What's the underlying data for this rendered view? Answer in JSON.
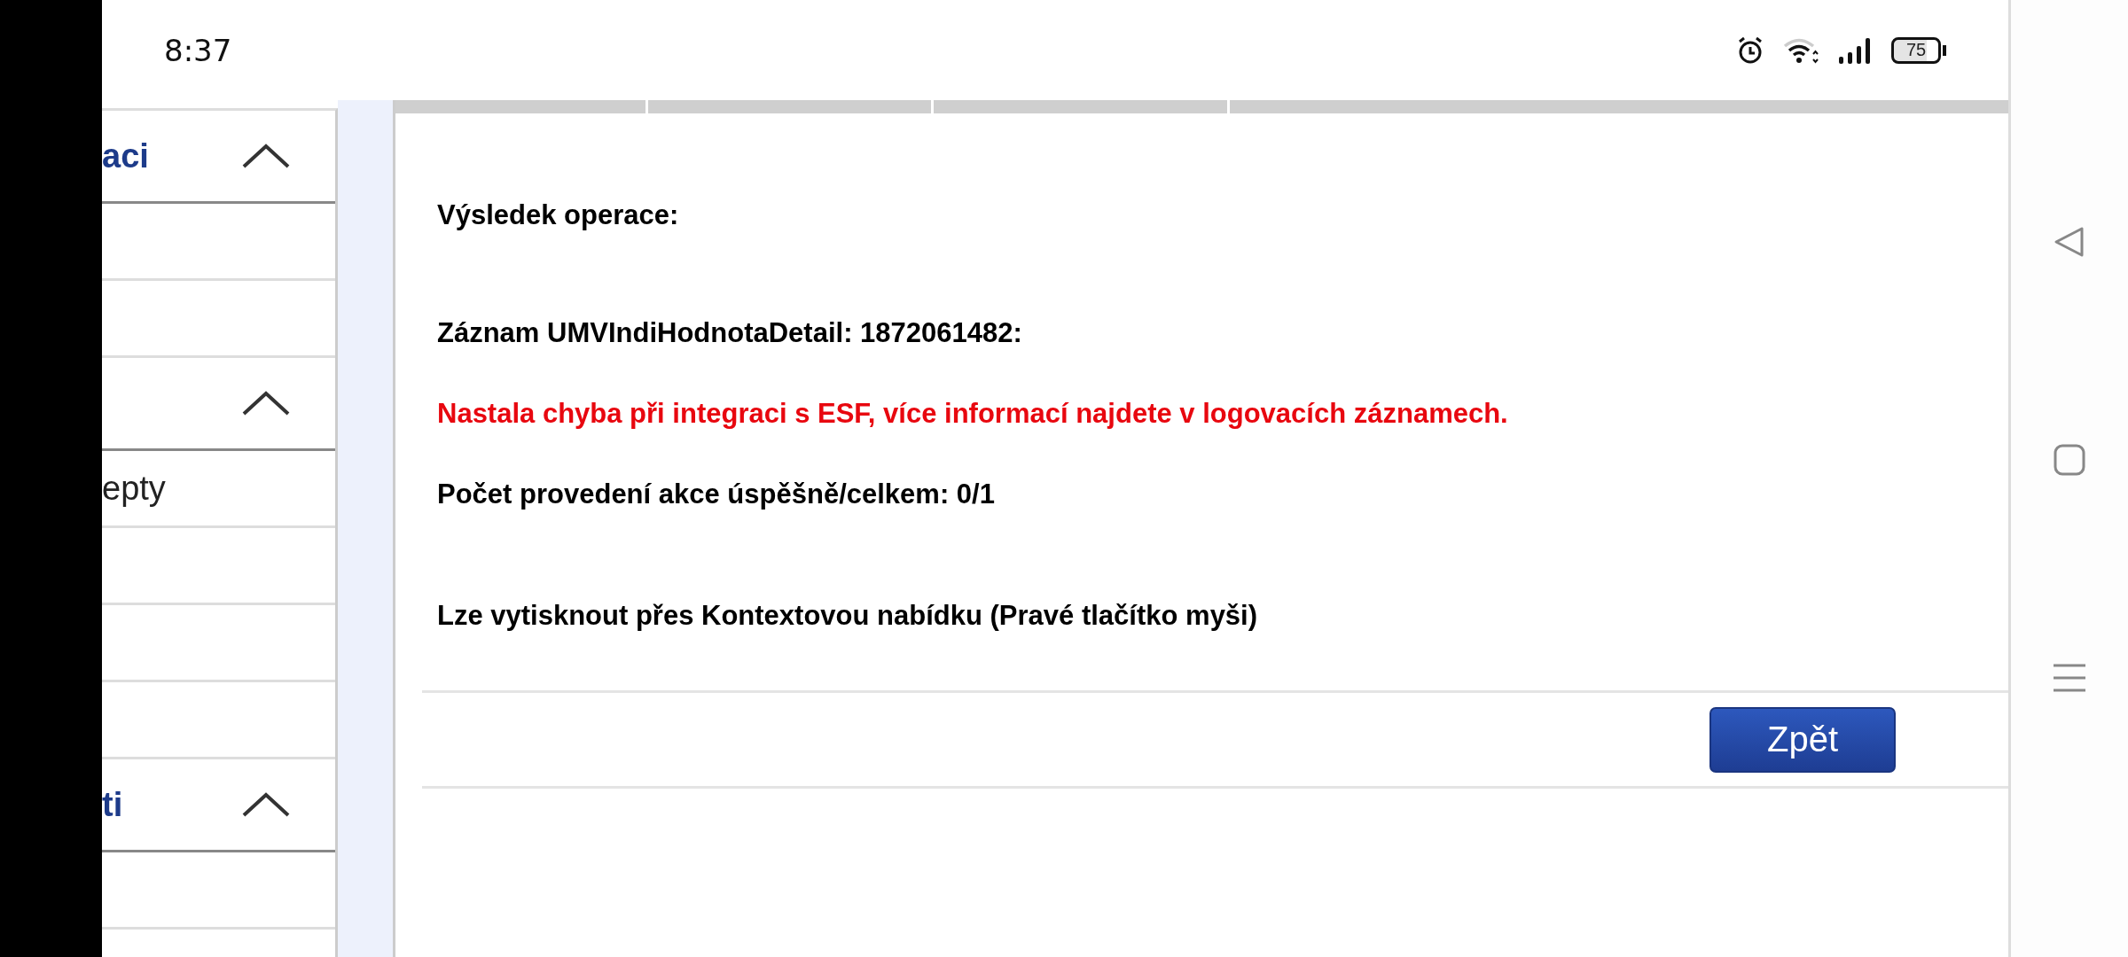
{
  "status_bar": {
    "time": "8:37",
    "battery": "75"
  },
  "sidebar": {
    "items": [
      {
        "kind": "header",
        "label": "aci",
        "expanded": true
      },
      {
        "kind": "row"
      },
      {
        "kind": "row"
      },
      {
        "kind": "header",
        "expanded": true
      },
      {
        "kind": "row",
        "label": "epty"
      },
      {
        "kind": "row"
      },
      {
        "kind": "row"
      },
      {
        "kind": "row"
      },
      {
        "kind": "header",
        "label": "ti",
        "expanded": true
      },
      {
        "kind": "row"
      }
    ]
  },
  "result": {
    "title": "Výsledek operace:",
    "record": "Záznam UMVIndiHodnotaDetail: 1872061482:",
    "error": "Nastala chyba při integraci s ESF, více informací najdete v logovacích záznamech.",
    "count": "Počet provedení akce úspěšně/celkem: 0/1",
    "print_hint": "Lze vytisknout přes Kontextovou nabídku (Pravé tlačítko myši)"
  },
  "back_button": "Zpět"
}
